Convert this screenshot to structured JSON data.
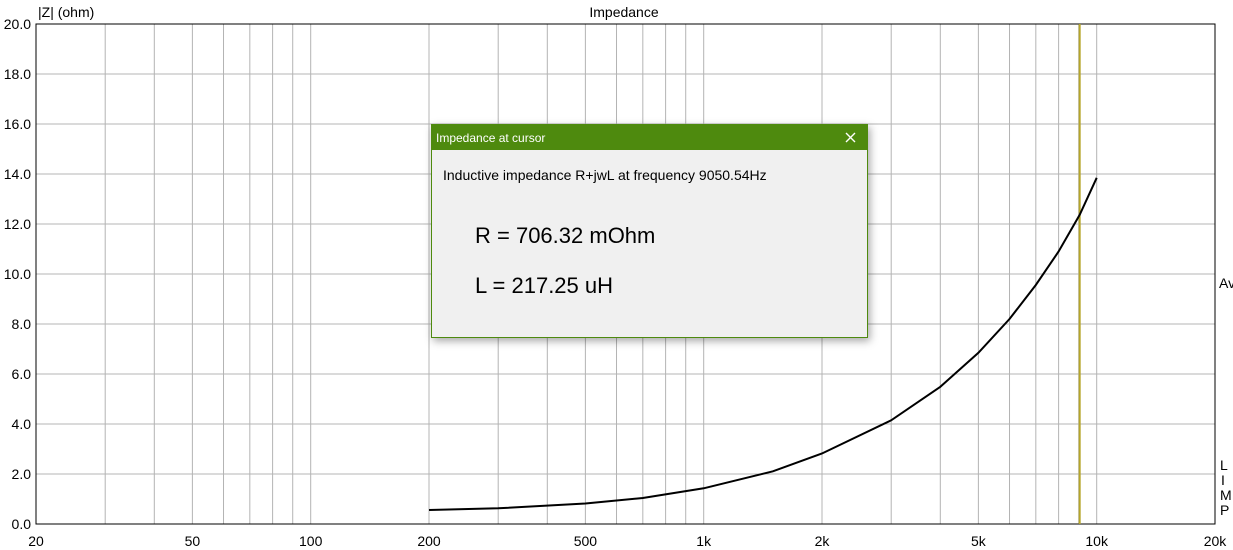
{
  "chart_data": {
    "type": "line",
    "title": "Impedance",
    "ylabel": "|Z| (ohm)",
    "xlabel": "",
    "x_scale": "log",
    "xlim": [
      20,
      20000
    ],
    "ylim": [
      0,
      20
    ],
    "grid": true,
    "x_ticks": [
      20,
      50,
      100,
      200,
      500,
      1000,
      2000,
      5000,
      10000,
      20000
    ],
    "x_tick_labels": [
      "20",
      "50",
      "100",
      "200",
      "500",
      "1k",
      "2k",
      "5k",
      "10k",
      "20k"
    ],
    "y_ticks": [
      0,
      2,
      4,
      6,
      8,
      10,
      12,
      14,
      16,
      18,
      20
    ],
    "y_tick_labels": [
      "0.0",
      "2.0",
      "4.0",
      "6.0",
      "8.0",
      "10.0",
      "12.0",
      "14.0",
      "16.0",
      "18.0",
      "20.0"
    ],
    "series": [
      {
        "x": [
          200,
          300,
          500,
          700,
          1000,
          1500,
          2000,
          3000,
          4000,
          5000,
          6000,
          7000,
          8000,
          9050,
          10000
        ],
        "y": [
          0.56,
          0.63,
          0.82,
          1.04,
          1.43,
          2.11,
          2.82,
          4.15,
          5.49,
          6.85,
          8.2,
          9.56,
          10.9,
          12.37,
          13.85
        ],
        "color": "#000000"
      }
    ],
    "cursor": {
      "x": 9050.54,
      "color": "#b5a52a"
    },
    "right_labels": [
      "Av",
      "L",
      "I",
      "M",
      "P"
    ]
  },
  "dialog": {
    "title": "Impedance at cursor",
    "message": "Inductive impedance R+jwL at frequency 9050.54Hz",
    "r_value": "R = 706.32 mOhm",
    "l_value": "L = 217.25 uH"
  }
}
